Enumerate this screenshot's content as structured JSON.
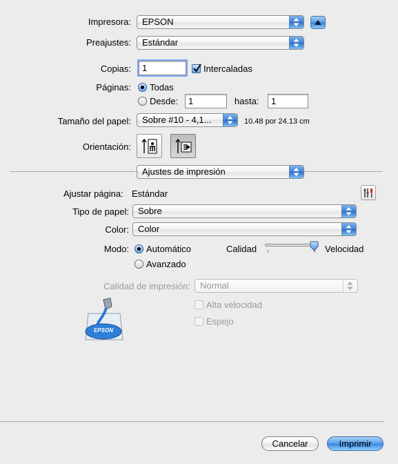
{
  "printer": {
    "label": "Impresora:",
    "value": "EPSON"
  },
  "presets": {
    "label": "Preajustes:",
    "value": "Estándar"
  },
  "copies": {
    "label": "Copias:",
    "value": "1",
    "collate_label": "Intercaladas",
    "collate_checked": true
  },
  "pages": {
    "label": "Páginas:",
    "all_label": "Todas",
    "from_label": "Desde:",
    "from_value": "1",
    "to_label": "hasta:",
    "to_value": "1",
    "selected": "all"
  },
  "paper_size": {
    "label": "Tamaño del papel:",
    "value": "Sobre #10 - 4,1...",
    "dimensions": "10.48 por 24.13 cm"
  },
  "orientation": {
    "label": "Orientación:",
    "options": [
      "portrait-icon",
      "landscape-icon"
    ],
    "selected": "landscape-icon"
  },
  "panel": {
    "value": "Ajustes de impresión"
  },
  "fit_page": {
    "label": "Ajustar página:",
    "value": "Estándar"
  },
  "paper_type": {
    "label": "Tipo de papel:",
    "value": "Sobre"
  },
  "color": {
    "label": "Color:",
    "value": "Color"
  },
  "mode": {
    "label": "Modo:",
    "automatic_label": "Automático",
    "advanced_label": "Avanzado",
    "selected": "automatic",
    "quality_label": "Calidad",
    "speed_label": "Velocidad",
    "slider_position": 1.0
  },
  "print_quality": {
    "label": "Calidad de impresión:",
    "value": "Normal",
    "disabled": true
  },
  "options": {
    "high_speed_label": "Alta velocidad",
    "mirror_label": "Espejo",
    "logo_text": "EPSON"
  },
  "buttons": {
    "cancel": "Cancelar",
    "print": "Imprimir"
  },
  "colors": {
    "accent": "#3a86e0",
    "background": "#ececec",
    "disabled_text": "#9a9a9a"
  }
}
